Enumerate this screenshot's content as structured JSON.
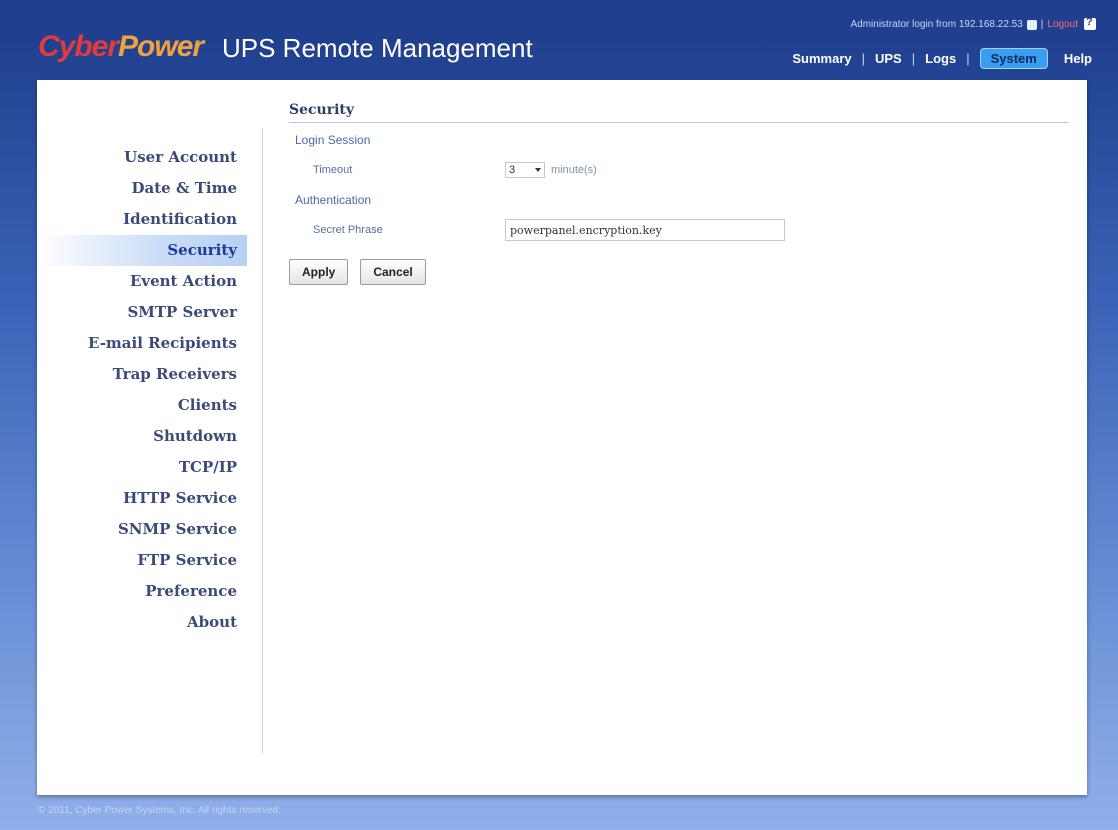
{
  "header": {
    "brand_part1": "Cyber",
    "brand_part2": "Power",
    "app_title": "UPS Remote Management",
    "login_text": "Administrator login from 192.168.22.53",
    "logout_label": "Logout",
    "nav": [
      {
        "label": "Summary"
      },
      {
        "label": "UPS"
      },
      {
        "label": "Logs"
      },
      {
        "label": "System",
        "active": true
      },
      {
        "label": "Help"
      }
    ]
  },
  "sidebar": {
    "items": [
      {
        "label": "User Account"
      },
      {
        "label": "Date & Time"
      },
      {
        "label": "Identification"
      },
      {
        "label": "Security",
        "active": true
      },
      {
        "label": "Event Action"
      },
      {
        "label": "SMTP Server"
      },
      {
        "label": "E-mail Recipients"
      },
      {
        "label": "Trap Receivers"
      },
      {
        "label": "Clients"
      },
      {
        "label": "Shutdown"
      },
      {
        "label": "TCP/IP"
      },
      {
        "label": "HTTP Service"
      },
      {
        "label": "SNMP Service"
      },
      {
        "label": "FTP Service"
      },
      {
        "label": "Preference"
      },
      {
        "label": "About"
      }
    ]
  },
  "content": {
    "section_title": "Security",
    "login_session": {
      "group_title": "Login Session",
      "timeout_label": "Timeout",
      "timeout_value": "3",
      "timeout_unit": "minute(s)"
    },
    "authentication": {
      "group_title": "Authentication",
      "secret_label": "Secret Phrase",
      "secret_value": "powerpanel.encryption.key"
    },
    "apply_label": "Apply",
    "cancel_label": "Cancel"
  },
  "footer": {
    "copyright": "© 2011, Cyber Power Systems, Inc. All rights reserved."
  },
  "colors": {
    "header_bg": "#20408f",
    "active_tab": "#3a9ef0",
    "sidebar_active": "#c9dcf7"
  }
}
